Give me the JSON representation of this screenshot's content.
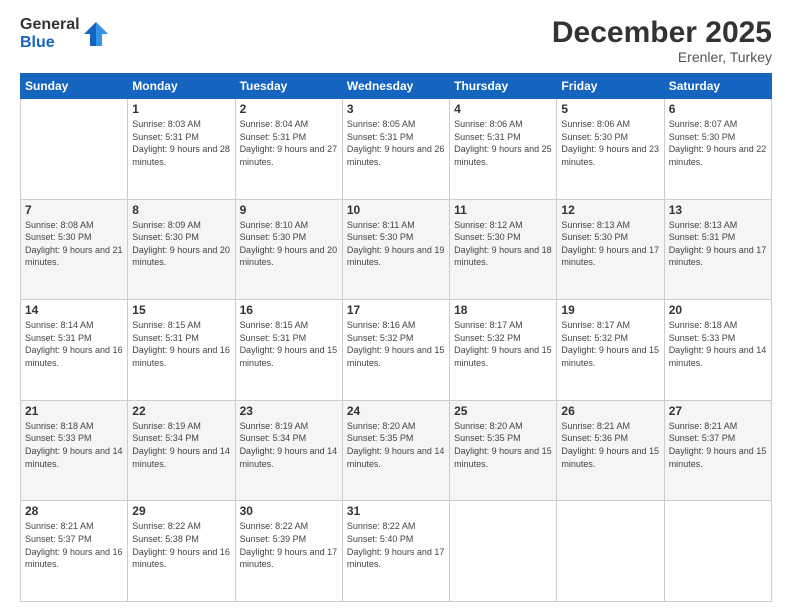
{
  "logo": {
    "line1": "General",
    "line2": "Blue"
  },
  "header": {
    "month": "December 2025",
    "location": "Erenler, Turkey"
  },
  "weekdays": [
    "Sunday",
    "Monday",
    "Tuesday",
    "Wednesday",
    "Thursday",
    "Friday",
    "Saturday"
  ],
  "weeks": [
    [
      {
        "day": "",
        "sunrise": "",
        "sunset": "",
        "daylight": ""
      },
      {
        "day": "1",
        "sunrise": "Sunrise: 8:03 AM",
        "sunset": "Sunset: 5:31 PM",
        "daylight": "Daylight: 9 hours and 28 minutes."
      },
      {
        "day": "2",
        "sunrise": "Sunrise: 8:04 AM",
        "sunset": "Sunset: 5:31 PM",
        "daylight": "Daylight: 9 hours and 27 minutes."
      },
      {
        "day": "3",
        "sunrise": "Sunrise: 8:05 AM",
        "sunset": "Sunset: 5:31 PM",
        "daylight": "Daylight: 9 hours and 26 minutes."
      },
      {
        "day": "4",
        "sunrise": "Sunrise: 8:06 AM",
        "sunset": "Sunset: 5:31 PM",
        "daylight": "Daylight: 9 hours and 25 minutes."
      },
      {
        "day": "5",
        "sunrise": "Sunrise: 8:06 AM",
        "sunset": "Sunset: 5:30 PM",
        "daylight": "Daylight: 9 hours and 23 minutes."
      },
      {
        "day": "6",
        "sunrise": "Sunrise: 8:07 AM",
        "sunset": "Sunset: 5:30 PM",
        "daylight": "Daylight: 9 hours and 22 minutes."
      }
    ],
    [
      {
        "day": "7",
        "sunrise": "Sunrise: 8:08 AM",
        "sunset": "Sunset: 5:30 PM",
        "daylight": "Daylight: 9 hours and 21 minutes."
      },
      {
        "day": "8",
        "sunrise": "Sunrise: 8:09 AM",
        "sunset": "Sunset: 5:30 PM",
        "daylight": "Daylight: 9 hours and 20 minutes."
      },
      {
        "day": "9",
        "sunrise": "Sunrise: 8:10 AM",
        "sunset": "Sunset: 5:30 PM",
        "daylight": "Daylight: 9 hours and 20 minutes."
      },
      {
        "day": "10",
        "sunrise": "Sunrise: 8:11 AM",
        "sunset": "Sunset: 5:30 PM",
        "daylight": "Daylight: 9 hours and 19 minutes."
      },
      {
        "day": "11",
        "sunrise": "Sunrise: 8:12 AM",
        "sunset": "Sunset: 5:30 PM",
        "daylight": "Daylight: 9 hours and 18 minutes."
      },
      {
        "day": "12",
        "sunrise": "Sunrise: 8:13 AM",
        "sunset": "Sunset: 5:30 PM",
        "daylight": "Daylight: 9 hours and 17 minutes."
      },
      {
        "day": "13",
        "sunrise": "Sunrise: 8:13 AM",
        "sunset": "Sunset: 5:31 PM",
        "daylight": "Daylight: 9 hours and 17 minutes."
      }
    ],
    [
      {
        "day": "14",
        "sunrise": "Sunrise: 8:14 AM",
        "sunset": "Sunset: 5:31 PM",
        "daylight": "Daylight: 9 hours and 16 minutes."
      },
      {
        "day": "15",
        "sunrise": "Sunrise: 8:15 AM",
        "sunset": "Sunset: 5:31 PM",
        "daylight": "Daylight: 9 hours and 16 minutes."
      },
      {
        "day": "16",
        "sunrise": "Sunrise: 8:15 AM",
        "sunset": "Sunset: 5:31 PM",
        "daylight": "Daylight: 9 hours and 15 minutes."
      },
      {
        "day": "17",
        "sunrise": "Sunrise: 8:16 AM",
        "sunset": "Sunset: 5:32 PM",
        "daylight": "Daylight: 9 hours and 15 minutes."
      },
      {
        "day": "18",
        "sunrise": "Sunrise: 8:17 AM",
        "sunset": "Sunset: 5:32 PM",
        "daylight": "Daylight: 9 hours and 15 minutes."
      },
      {
        "day": "19",
        "sunrise": "Sunrise: 8:17 AM",
        "sunset": "Sunset: 5:32 PM",
        "daylight": "Daylight: 9 hours and 15 minutes."
      },
      {
        "day": "20",
        "sunrise": "Sunrise: 8:18 AM",
        "sunset": "Sunset: 5:33 PM",
        "daylight": "Daylight: 9 hours and 14 minutes."
      }
    ],
    [
      {
        "day": "21",
        "sunrise": "Sunrise: 8:18 AM",
        "sunset": "Sunset: 5:33 PM",
        "daylight": "Daylight: 9 hours and 14 minutes."
      },
      {
        "day": "22",
        "sunrise": "Sunrise: 8:19 AM",
        "sunset": "Sunset: 5:34 PM",
        "daylight": "Daylight: 9 hours and 14 minutes."
      },
      {
        "day": "23",
        "sunrise": "Sunrise: 8:19 AM",
        "sunset": "Sunset: 5:34 PM",
        "daylight": "Daylight: 9 hours and 14 minutes."
      },
      {
        "day": "24",
        "sunrise": "Sunrise: 8:20 AM",
        "sunset": "Sunset: 5:35 PM",
        "daylight": "Daylight: 9 hours and 14 minutes."
      },
      {
        "day": "25",
        "sunrise": "Sunrise: 8:20 AM",
        "sunset": "Sunset: 5:35 PM",
        "daylight": "Daylight: 9 hours and 15 minutes."
      },
      {
        "day": "26",
        "sunrise": "Sunrise: 8:21 AM",
        "sunset": "Sunset: 5:36 PM",
        "daylight": "Daylight: 9 hours and 15 minutes."
      },
      {
        "day": "27",
        "sunrise": "Sunrise: 8:21 AM",
        "sunset": "Sunset: 5:37 PM",
        "daylight": "Daylight: 9 hours and 15 minutes."
      }
    ],
    [
      {
        "day": "28",
        "sunrise": "Sunrise: 8:21 AM",
        "sunset": "Sunset: 5:37 PM",
        "daylight": "Daylight: 9 hours and 16 minutes."
      },
      {
        "day": "29",
        "sunrise": "Sunrise: 8:22 AM",
        "sunset": "Sunset: 5:38 PM",
        "daylight": "Daylight: 9 hours and 16 minutes."
      },
      {
        "day": "30",
        "sunrise": "Sunrise: 8:22 AM",
        "sunset": "Sunset: 5:39 PM",
        "daylight": "Daylight: 9 hours and 17 minutes."
      },
      {
        "day": "31",
        "sunrise": "Sunrise: 8:22 AM",
        "sunset": "Sunset: 5:40 PM",
        "daylight": "Daylight: 9 hours and 17 minutes."
      },
      {
        "day": "",
        "sunrise": "",
        "sunset": "",
        "daylight": ""
      },
      {
        "day": "",
        "sunrise": "",
        "sunset": "",
        "daylight": ""
      },
      {
        "day": "",
        "sunrise": "",
        "sunset": "",
        "daylight": ""
      }
    ]
  ]
}
